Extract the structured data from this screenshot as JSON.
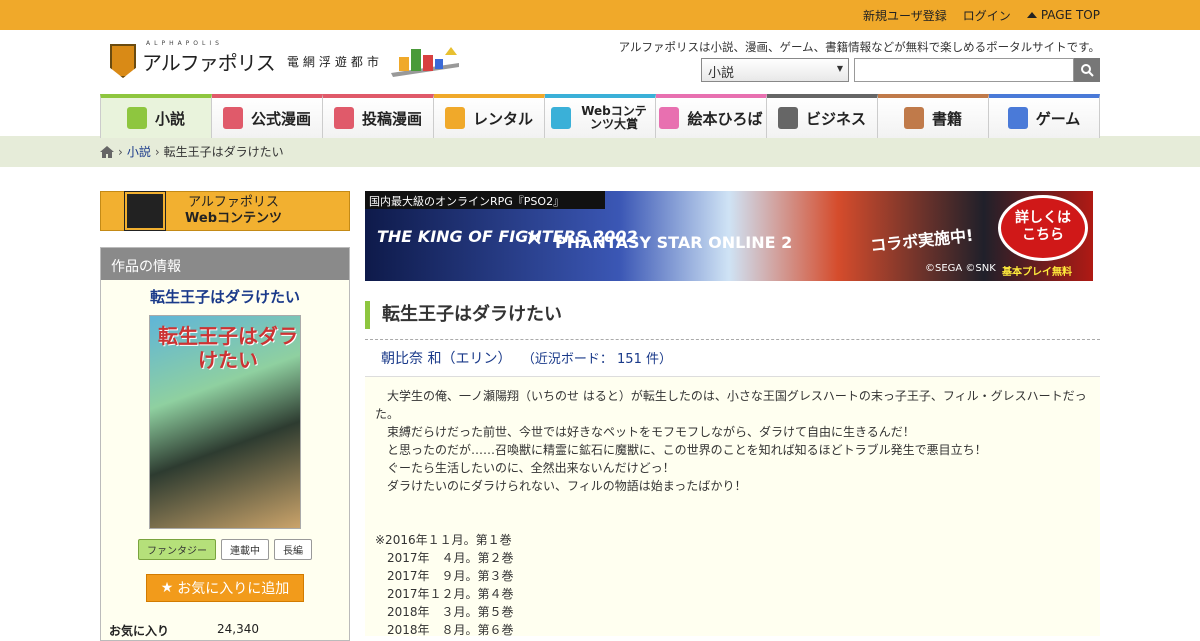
{
  "topbar": {
    "register": "新規ユーザ登録",
    "login": "ログイン",
    "pagetop": "PAGE TOP"
  },
  "header": {
    "logo_sub": "ALPHAPOLIS",
    "logo_text": "アルファポリス",
    "logo_city": "電網浮遊都市",
    "tagline": "アルファポリスは小説、漫画、ゲーム、書籍情報などが無料で楽しめるポータルサイトです。",
    "search_category": "小説"
  },
  "nav": [
    {
      "label": "小説",
      "color": "#8ec63f",
      "icon": "book-icon"
    },
    {
      "label": "公式漫画",
      "color": "#e05a6a",
      "icon": "manga-icon"
    },
    {
      "label": "投稿漫画",
      "color": "#e05a6a",
      "icon": "manga-post-icon"
    },
    {
      "label": "レンタル",
      "color": "#f0a92a",
      "icon": "rental-icon"
    },
    {
      "label": "Webコンテンツ大賞",
      "color": "#3ab0d8",
      "icon": "award-icon"
    },
    {
      "label": "絵本ひろば",
      "color": "#e870b0",
      "icon": "picturebook-icon"
    },
    {
      "label": "ビジネス",
      "color": "#666666",
      "icon": "business-icon"
    },
    {
      "label": "書籍",
      "color": "#c07a4a",
      "icon": "books-icon"
    },
    {
      "label": "ゲーム",
      "color": "#4a7ad8",
      "icon": "game-icon"
    }
  ],
  "breadcrumb": {
    "home": "home",
    "novel": "小説",
    "current": "転生王子はダラけたい"
  },
  "left": {
    "banner_line1": "アルファポリス",
    "banner_line2": "Webコンテンツ",
    "info_header": "作品の情報",
    "work_title": "転生王子はダラけたい",
    "cover_text": "転生王子はダラけたい",
    "tags": [
      "ファンタジー",
      "連載中",
      "長編"
    ],
    "fav_button": "お気に入りに追加",
    "fav_label": "お気に入り",
    "fav_count": "24,340"
  },
  "ad": {
    "top": "国内最大級のオンラインRPG『PSO2』",
    "kof": "THE KING OF FIGHTERS 2002",
    "x": "✕",
    "pso": "PHANTASY STAR ONLINE 2",
    "collab": "コラボ実施中!",
    "cta": "詳しくは\nこちら",
    "copy": "©SEGA ©SNK",
    "free": "基本プレイ無料"
  },
  "novel": {
    "title": "転生王子はダラけたい",
    "author": "朝比奈 和（エリン）",
    "board": "（近況ボード： 151 件）",
    "synopsis": "　大学生の俺、一ノ瀬陽翔（いちのせ はると）が転生したのは、小さな王国グレスハートの末っ子王子、フィル・グレスハートだった。\n　束縛だらけだった前世、今世では好きなペットをモフモフしながら、ダラけて自由に生きるんだ！\n　と思ったのだが……召喚獣に精霊に鉱石に魔獣に、この世界のことを知れば知るほどトラブル発生で悪目立ち！\n　ぐーたら生活したいのに、全然出来ないんだけどっ！\n　ダラけたいのにダラけられない、フィルの物語は始まったばかり！\n\n\n※2016年１１月。第１巻\n　2017年　４月。第２巻\n　2017年　９月。第３巻\n　2017年１２月。第４巻\n　2018年　３月。第５巻\n　2018年　８月。第６巻"
  }
}
